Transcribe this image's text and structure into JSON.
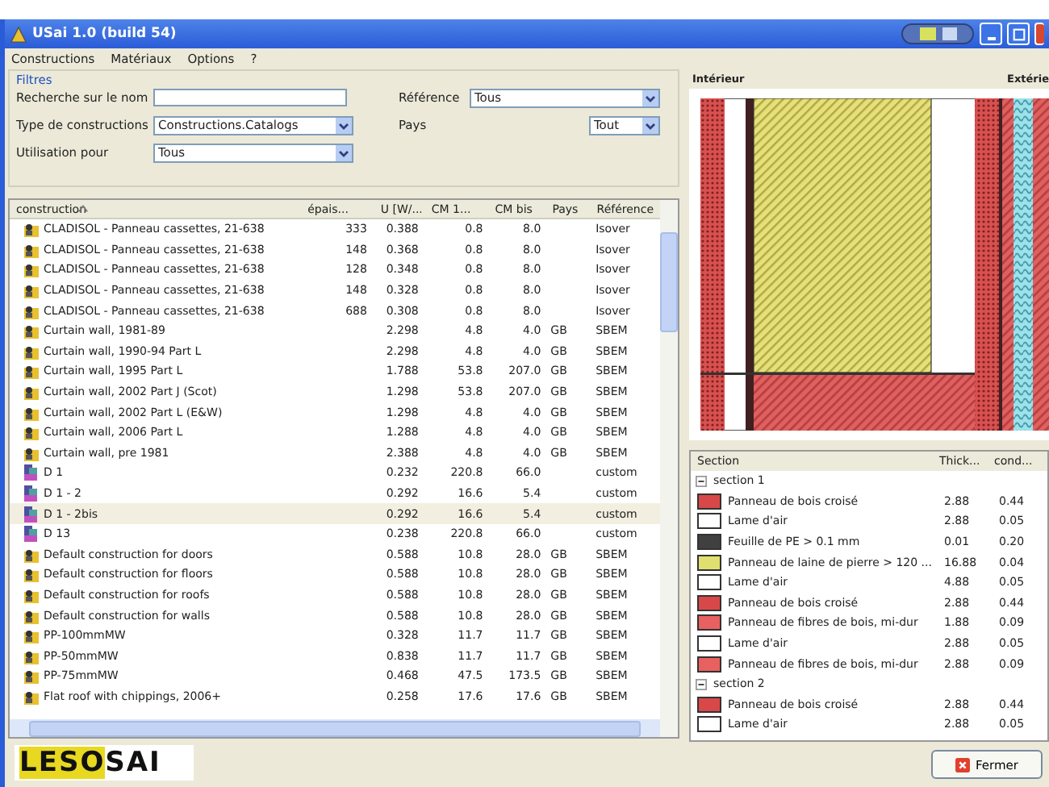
{
  "window": {
    "title": "USai 1.0 (build 54)"
  },
  "menu": [
    {
      "label": "Constructions"
    },
    {
      "label": "Matériaux"
    },
    {
      "label": "Options"
    },
    {
      "label": "?"
    }
  ],
  "filters": {
    "title": "Filtres",
    "fields": [
      {
        "label": "Recherche sur le nom",
        "kind": "text"
      },
      {
        "label": "Type de constructions",
        "kind": "select",
        "value": "Constructions.Catalogs"
      },
      {
        "label": "Utilisation pour",
        "kind": "select",
        "value": "Tous"
      }
    ],
    "right_fields": [
      {
        "label": "Référence",
        "value": "Tous"
      },
      {
        "label": "Pays",
        "value": "Tout"
      }
    ]
  },
  "table": {
    "columns": [
      "construction",
      "épais...",
      "U [W/...",
      "CM 1...",
      "CM bis",
      "Pays",
      "Référence"
    ],
    "rows": [
      {
        "kind": "catalog",
        "selected": false,
        "cells": [
          "CLADISOL - Panneau cassettes, 21-638",
          "333",
          "0.388",
          "0.8",
          "8.0",
          "",
          "Isover"
        ]
      },
      {
        "kind": "catalog",
        "selected": false,
        "cells": [
          "CLADISOL - Panneau cassettes, 21-638",
          "148",
          "0.368",
          "0.8",
          "8.0",
          "",
          "Isover"
        ]
      },
      {
        "kind": "catalog",
        "selected": false,
        "cells": [
          "CLADISOL - Panneau cassettes, 21-638",
          "128",
          "0.348",
          "0.8",
          "8.0",
          "",
          "Isover"
        ]
      },
      {
        "kind": "catalog",
        "selected": false,
        "cells": [
          "CLADISOL - Panneau cassettes, 21-638",
          "148",
          "0.328",
          "0.8",
          "8.0",
          "",
          "Isover"
        ]
      },
      {
        "kind": "catalog",
        "selected": false,
        "cells": [
          "CLADISOL - Panneau cassettes, 21-638",
          "688",
          "0.308",
          "0.8",
          "8.0",
          "",
          "Isover"
        ]
      },
      {
        "kind": "catalog",
        "selected": false,
        "cells": [
          "Curtain wall, 1981-89",
          "",
          "2.298",
          "4.8",
          "4.0",
          "GB",
          "SBEM"
        ]
      },
      {
        "kind": "catalog",
        "selected": false,
        "cells": [
          "Curtain wall, 1990-94 Part L",
          "",
          "2.298",
          "4.8",
          "4.0",
          "GB",
          "SBEM"
        ]
      },
      {
        "kind": "catalog",
        "selected": false,
        "cells": [
          "Curtain wall, 1995 Part L",
          "",
          "1.788",
          "53.8",
          "207.0",
          "GB",
          "SBEM"
        ]
      },
      {
        "kind": "catalog",
        "selected": false,
        "cells": [
          "Curtain wall, 2002 Part J (Scot)",
          "",
          "1.298",
          "53.8",
          "207.0",
          "GB",
          "SBEM"
        ]
      },
      {
        "kind": "catalog",
        "selected": false,
        "cells": [
          "Curtain wall, 2002 Part L (E&W)",
          "",
          "1.298",
          "4.8",
          "4.0",
          "GB",
          "SBEM"
        ]
      },
      {
        "kind": "catalog",
        "selected": false,
        "cells": [
          "Curtain wall, 2006 Part L",
          "",
          "1.288",
          "4.8",
          "4.0",
          "GB",
          "SBEM"
        ]
      },
      {
        "kind": "catalog",
        "selected": false,
        "cells": [
          "Curtain wall, pre 1981",
          "",
          "2.388",
          "4.8",
          "4.0",
          "GB",
          "SBEM"
        ]
      },
      {
        "kind": "custom",
        "selected": false,
        "cells": [
          "D 1",
          "",
          "0.232",
          "220.8",
          "66.0",
          "",
          "custom"
        ]
      },
      {
        "kind": "custom",
        "selected": false,
        "cells": [
          "D 1 - 2",
          "",
          "0.292",
          "16.6",
          "5.4",
          "",
          "custom"
        ]
      },
      {
        "kind": "custom",
        "selected": true,
        "cells": [
          "D 1 - 2bis",
          "",
          "0.292",
          "16.6",
          "5.4",
          "",
          "custom"
        ]
      },
      {
        "kind": "custom",
        "selected": false,
        "cells": [
          "D 13",
          "",
          "0.238",
          "220.8",
          "66.0",
          "",
          "custom"
        ]
      },
      {
        "kind": "catalog",
        "selected": false,
        "cells": [
          "Default construction for doors",
          "",
          "0.588",
          "10.8",
          "28.0",
          "GB",
          "SBEM"
        ]
      },
      {
        "kind": "catalog",
        "selected": false,
        "cells": [
          "Default construction for floors",
          "",
          "0.588",
          "10.8",
          "28.0",
          "GB",
          "SBEM"
        ]
      },
      {
        "kind": "catalog",
        "selected": false,
        "cells": [
          "Default construction for roofs",
          "",
          "0.588",
          "10.8",
          "28.0",
          "GB",
          "SBEM"
        ]
      },
      {
        "kind": "catalog",
        "selected": false,
        "cells": [
          "Default construction for walls",
          "",
          "0.588",
          "10.8",
          "28.0",
          "GB",
          "SBEM"
        ]
      },
      {
        "kind": "catalog",
        "selected": false,
        "cells": [
          "PP-100mmMW",
          "",
          "0.328",
          "11.7",
          "11.7",
          "GB",
          "SBEM"
        ]
      },
      {
        "kind": "catalog",
        "selected": false,
        "cells": [
          "PP-50mmMW",
          "",
          "0.838",
          "11.7",
          "11.7",
          "GB",
          "SBEM"
        ]
      },
      {
        "kind": "catalog",
        "selected": false,
        "cells": [
          "PP-75mmMW",
          "",
          "0.468",
          "47.5",
          "173.5",
          "GB",
          "SBEM"
        ]
      },
      {
        "kind": "catalog",
        "selected": false,
        "cells": [
          "Flat roof with chippings, 2006+",
          "",
          "0.258",
          "17.6",
          "17.6",
          "GB",
          "SBEM"
        ]
      }
    ]
  },
  "logo": {
    "part_1": "LESO",
    "part_2": "SAI"
  },
  "preview": {
    "inside_label": "Intérieur",
    "outside_label": "Extérie"
  },
  "layers": {
    "columns": [
      "Section",
      "Thick...",
      "cond..."
    ],
    "sections": [
      {
        "name": "section 1",
        "expanded": true,
        "children": [
          {
            "name": "Panneau de bois croisé",
            "color": "#d84848",
            "thickness": "2.88",
            "conductivity": "0.44"
          },
          {
            "name": "Lame d'air",
            "color": "#ffffff",
            "thickness": "2.88",
            "conductivity": "0.05"
          },
          {
            "name": "Feuille de PE > 0.1 mm",
            "color": "#404040",
            "thickness": "0.01",
            "conductivity": "0.20"
          },
          {
            "name": "Panneau de laine de pierre > 120 ...",
            "color": "#e0e070",
            "thickness": "16.88",
            "conductivity": "0.04"
          },
          {
            "name": "Lame d'air",
            "color": "#ffffff",
            "thickness": "4.88",
            "conductivity": "0.05"
          },
          {
            "name": "Panneau de bois croisé",
            "color": "#d84848",
            "thickness": "2.88",
            "conductivity": "0.44"
          },
          {
            "name": "Panneau de fibres de bois, mi-dur",
            "color": "#e86060",
            "thickness": "1.88",
            "conductivity": "0.09"
          },
          {
            "name": "Lame d'air",
            "color": "#ffffff",
            "thickness": "2.88",
            "conductivity": "0.05"
          },
          {
            "name": "Panneau de fibres de bois, mi-dur",
            "color": "#e86060",
            "thickness": "2.88",
            "conductivity": "0.09"
          }
        ]
      },
      {
        "name": "section 2",
        "expanded": true,
        "children": [
          {
            "name": "Panneau de bois croisé",
            "color": "#d84848",
            "thickness": "2.88",
            "conductivity": "0.44"
          },
          {
            "name": "Lame d'air",
            "color": "#ffffff",
            "thickness": "2.88",
            "conductivity": "0.05"
          }
        ]
      }
    ]
  },
  "buttons": [
    {
      "label": "Fermer"
    }
  ]
}
